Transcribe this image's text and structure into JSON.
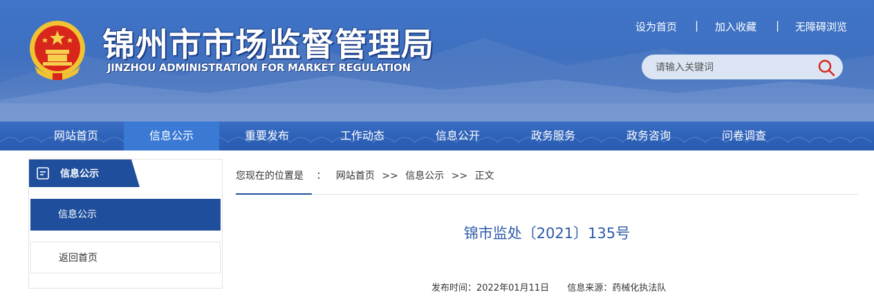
{
  "header": {
    "title": "锦州市市场监督管理局",
    "subtitle": "JINZHOU ADMINISTRATION FOR MARKET REGULATION",
    "top_links": [
      "设为首页",
      "|",
      "加入收藏",
      "|",
      "无障碍浏览"
    ],
    "search": {
      "placeholder": "请输入关键词"
    }
  },
  "nav": {
    "items": [
      "网站首页",
      "信息公示",
      "重要发布",
      "工作动态",
      "信息公开",
      "政务服务",
      "政务咨询",
      "问卷调查"
    ],
    "active": "信息公示"
  },
  "sidebar": {
    "heading": "信息公示",
    "links": [
      "信息公示",
      "返回首页"
    ]
  },
  "breadcrumb": {
    "label": "您现在的位置是",
    "colon": "：",
    "items": [
      "网站首页",
      ">>",
      "信息公示",
      ">>",
      "正文"
    ]
  },
  "article": {
    "title": "锦市监处〔2021〕135号",
    "published_label": "发布时间：",
    "published": "2022年01月11日",
    "source_label": "信息来源：",
    "source": "药械化执法队"
  },
  "colors": {
    "brand": "#1f4f9c",
    "title": "#2e5aa8",
    "banner": "#3f72c4"
  },
  "icons": {
    "emblem": "national-emblem-icon",
    "search": "search-icon",
    "sidebar": "document-icon"
  }
}
